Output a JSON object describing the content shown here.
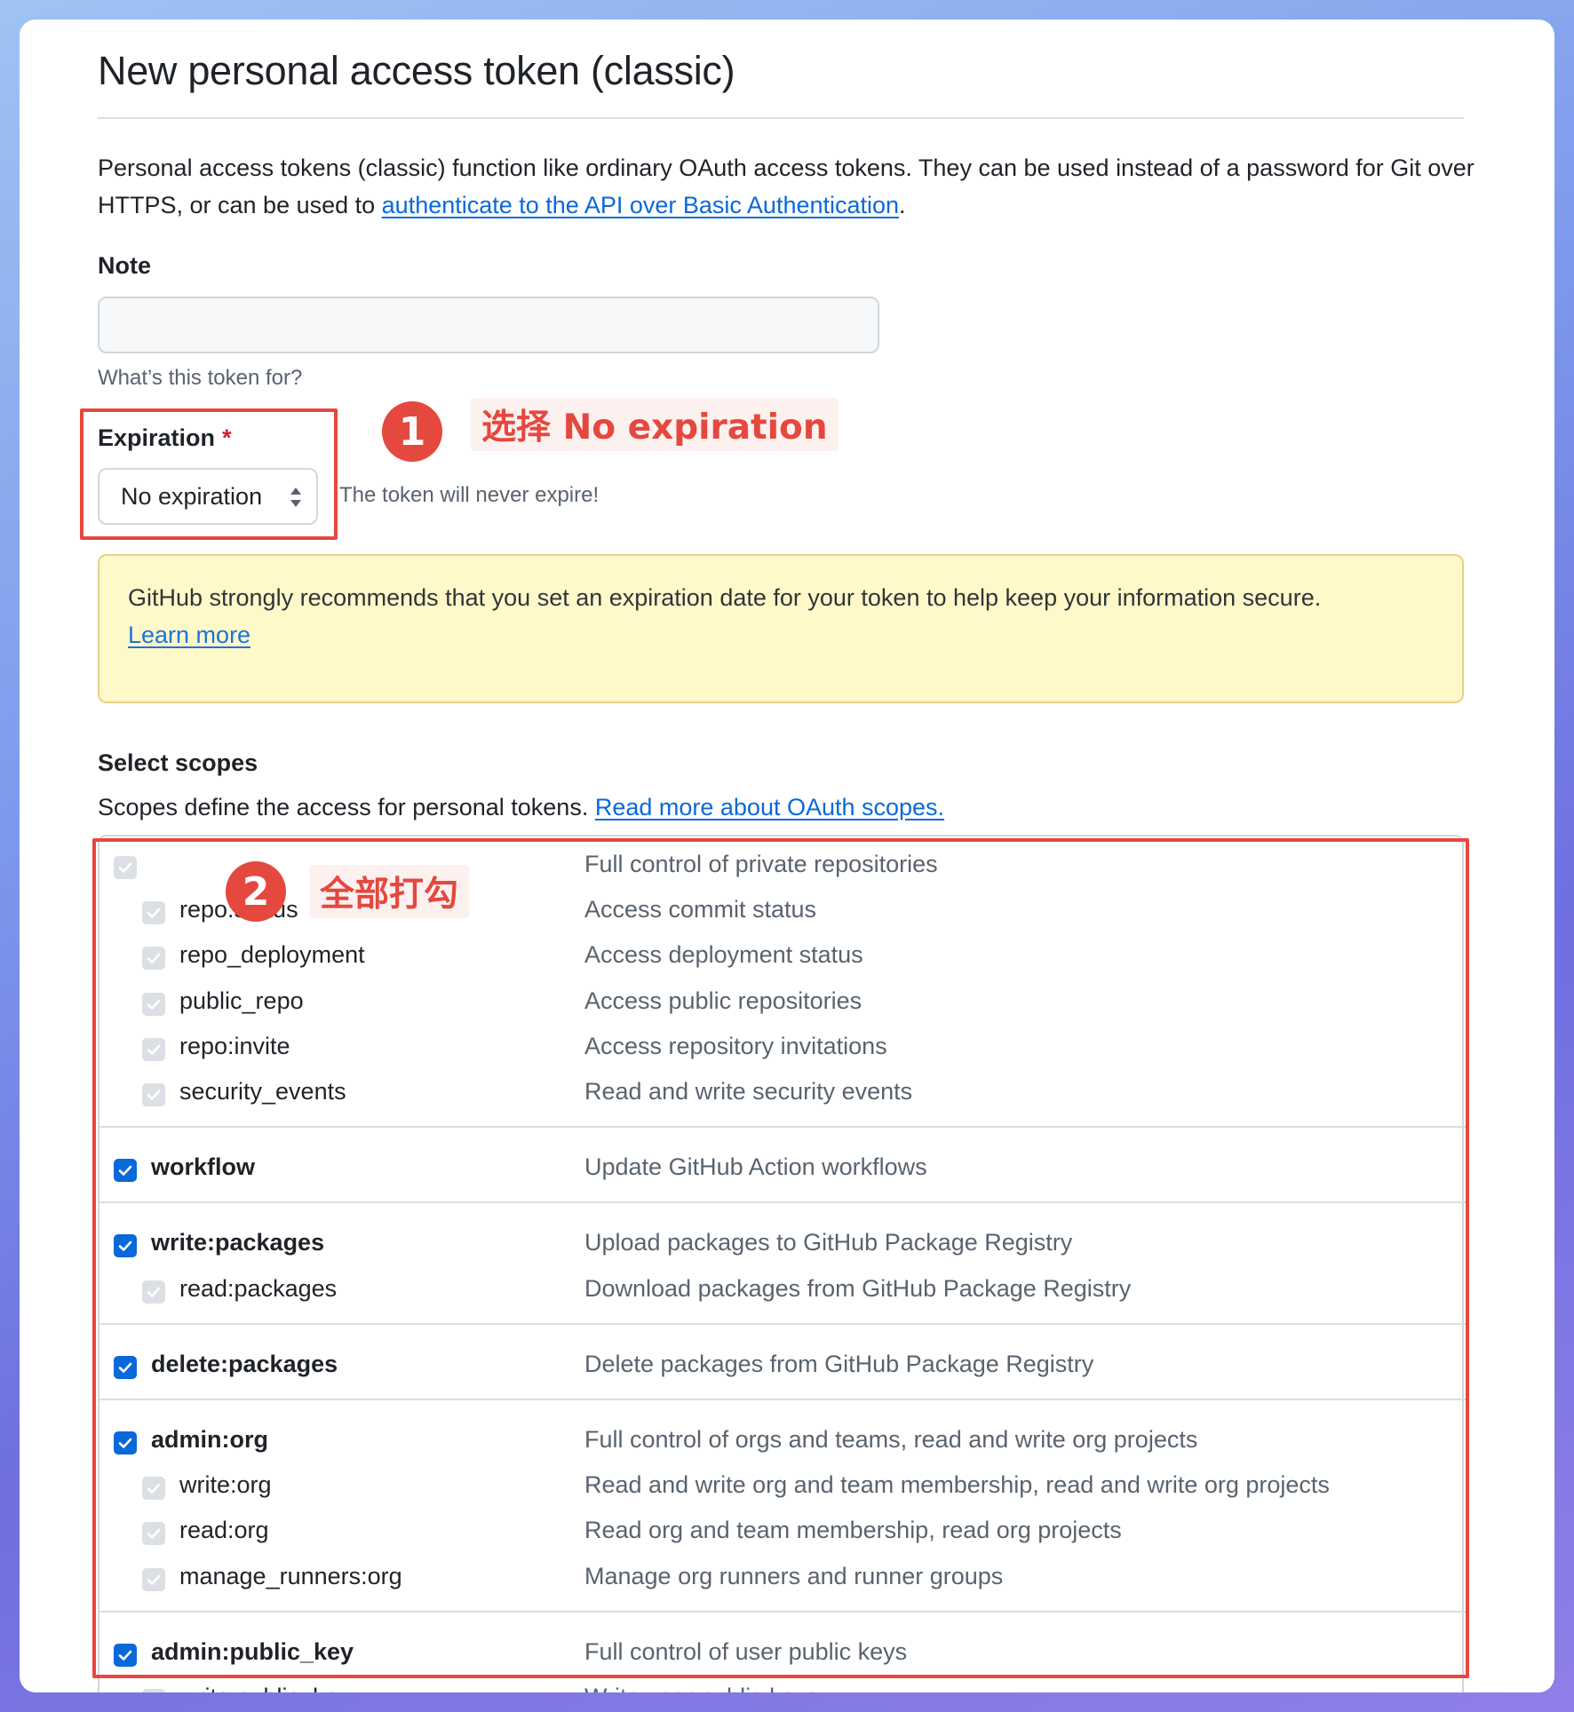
{
  "page": {
    "title": "New personal access token (classic)",
    "intro_text": "Personal access tokens (classic) function like ordinary OAuth access tokens. They can be used instead of a password for Git over HTTPS, or can be used to ",
    "intro_link": "authenticate to the API over Basic Authentication",
    "intro_end": "."
  },
  "note": {
    "label": "Note",
    "value": "",
    "hint": "What’s this token for?"
  },
  "expiration": {
    "label": "Expiration",
    "required_mark": "*",
    "selected": "No expiration",
    "note": "The token will never expire!"
  },
  "annotations": {
    "step1_number": "1",
    "step1_text": "选择 No expiration",
    "step2_number": "2",
    "step2_text": "全部打勾",
    "accent_color": "#e5483e"
  },
  "warning": {
    "text": "GitHub strongly recommends that you set an expiration date for your token to help keep your information secure.",
    "link": "Learn more"
  },
  "scopes": {
    "heading": "Select scopes",
    "desc": "Scopes define the access for personal tokens. ",
    "desc_link": "Read more about OAuth scopes.",
    "groups": [
      {
        "name": "",
        "checked": true,
        "description": "Full control of private repositories",
        "children": [
          {
            "name": "repo:status",
            "description": "Access commit status"
          },
          {
            "name": "repo_deployment",
            "description": "Access deployment status"
          },
          {
            "name": "public_repo",
            "description": "Access public repositories"
          },
          {
            "name": "repo:invite",
            "description": "Access repository invitations"
          },
          {
            "name": "security_events",
            "description": "Read and write security events"
          }
        ]
      },
      {
        "name": "workflow",
        "checked": true,
        "description": "Update GitHub Action workflows",
        "children": []
      },
      {
        "name": "write:packages",
        "checked": true,
        "description": "Upload packages to GitHub Package Registry",
        "children": [
          {
            "name": "read:packages",
            "description": "Download packages from GitHub Package Registry"
          }
        ]
      },
      {
        "name": "delete:packages",
        "checked": true,
        "description": "Delete packages from GitHub Package Registry",
        "children": []
      },
      {
        "name": "admin:org",
        "checked": true,
        "description": "Full control of orgs and teams, read and write org projects",
        "children": [
          {
            "name": "write:org",
            "description": "Read and write org and team membership, read and write org projects"
          },
          {
            "name": "read:org",
            "description": "Read org and team membership, read org projects"
          },
          {
            "name": "manage_runners:org",
            "description": "Manage org runners and runner groups"
          }
        ]
      },
      {
        "name": "admin:public_key",
        "checked": true,
        "description": "Full control of user public keys",
        "children": [
          {
            "name": "write:public_key",
            "description": "Write user public keys"
          }
        ]
      }
    ]
  }
}
